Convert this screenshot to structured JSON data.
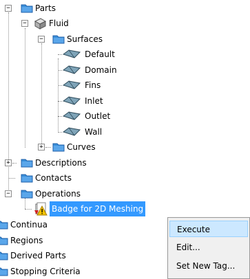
{
  "tree": {
    "parts": "Parts",
    "fluid": "Fluid",
    "surfaces": "Surfaces",
    "surface_items": [
      "Default",
      "Domain",
      "Fins",
      "Inlet",
      "Outlet",
      "Wall"
    ],
    "curves": "Curves",
    "descriptions": "Descriptions",
    "contacts": "Contacts",
    "operations": "Operations",
    "badge": "Badge for 2D Meshing",
    "continua": "Continua",
    "regions": "Regions",
    "derived_parts": "Derived Parts",
    "stopping_criteria": "Stopping Criteria"
  },
  "context_menu": {
    "execute": "Execute",
    "edit": "Edit...",
    "set_new_tag": "Set New Tag..."
  },
  "colors": {
    "selection": "#3399ff",
    "folder": "#3a8fd9",
    "menu_highlight": "#cce8ff"
  }
}
